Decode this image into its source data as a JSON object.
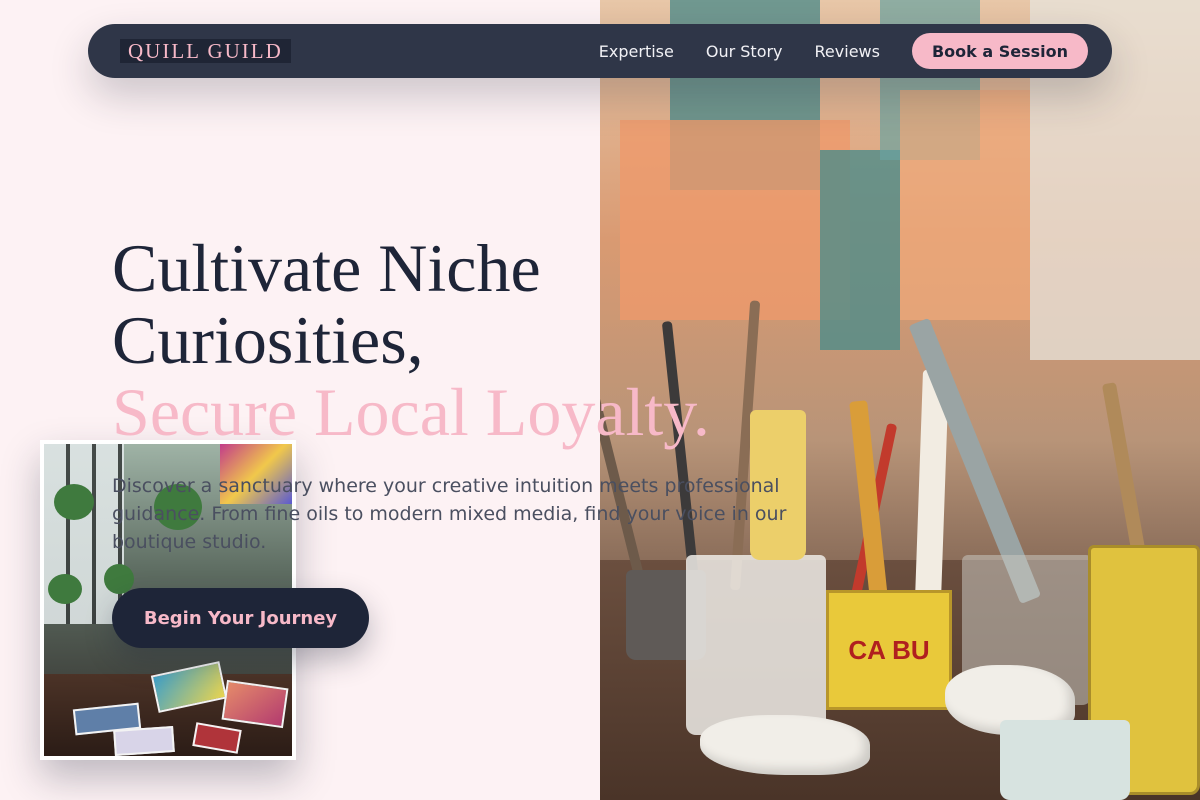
{
  "nav": {
    "logo": "QUILL GUILD",
    "links": [
      {
        "label": "Expertise"
      },
      {
        "label": "Our Story"
      },
      {
        "label": "Reviews"
      }
    ],
    "cta_label": "Book a Session"
  },
  "hero": {
    "title_line1": "Cultivate Niche",
    "title_line2": "Curiosities,",
    "title_accent": "Secure Local Loyalty.",
    "description": "Discover a sanctuary where your creative intuition meets professional guidance. From fine oils to modern mixed media, find your voice in our boutique studio.",
    "cta_label": "Begin Your Journey"
  },
  "photo": {
    "can_label": "CA BU"
  },
  "colors": {
    "background": "#fdf2f4",
    "navy": "#1e2538",
    "nav_bg": "#2f3648",
    "accent_pink": "#f7b9c8",
    "body_text": "#4a4f60"
  }
}
